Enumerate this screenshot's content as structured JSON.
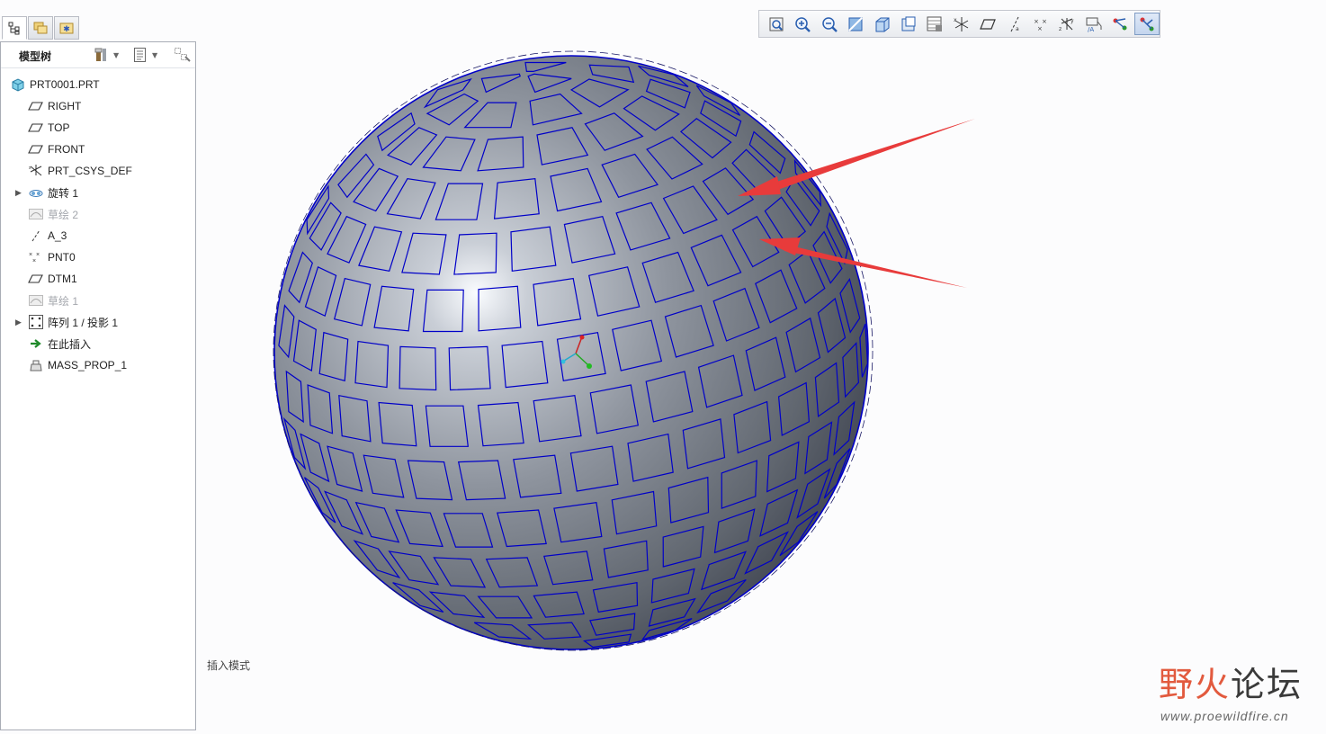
{
  "colors": {
    "accent": "#0000c8",
    "arrow": "#e83b3b",
    "panel_border": "#a9adb6",
    "watermark": "#e25a3e"
  },
  "tabs": [
    {
      "icon": "model-tree-icon",
      "active": true
    },
    {
      "icon": "folder-browser-icon",
      "active": false
    },
    {
      "icon": "favorites-icon",
      "active": false
    }
  ],
  "model_tree": {
    "title": "模型树",
    "header_icons": [
      "settings-tools-icon",
      "show-options-icon",
      "filter-icon"
    ],
    "items": [
      {
        "label": "PRT0001.PRT",
        "icon": "part-icon",
        "expandable": false,
        "muted": false
      },
      {
        "label": "RIGHT",
        "icon": "datum-plane-icon",
        "expandable": false,
        "muted": false
      },
      {
        "label": "TOP",
        "icon": "datum-plane-icon",
        "expandable": false,
        "muted": false
      },
      {
        "label": "FRONT",
        "icon": "datum-plane-icon",
        "expandable": false,
        "muted": false
      },
      {
        "label": "PRT_CSYS_DEF",
        "icon": "csys-icon",
        "expandable": false,
        "muted": false
      },
      {
        "label": "旋转 1",
        "icon": "revolve-icon",
        "expandable": true,
        "muted": false
      },
      {
        "label": "草绘 2",
        "icon": "sketch-icon",
        "expandable": false,
        "muted": true
      },
      {
        "label": "A_3",
        "icon": "datum-axis-icon",
        "expandable": false,
        "muted": false
      },
      {
        "label": "PNT0",
        "icon": "datum-point-icon",
        "expandable": false,
        "muted": false
      },
      {
        "label": "DTM1",
        "icon": "datum-plane-icon",
        "expandable": false,
        "muted": false
      },
      {
        "label": "草绘 1",
        "icon": "sketch-icon",
        "expandable": false,
        "muted": true
      },
      {
        "label": "阵列 1 / 投影 1",
        "icon": "pattern-icon",
        "expandable": true,
        "muted": false
      },
      {
        "label": "在此插入",
        "icon": "insert-here-icon",
        "expandable": false,
        "muted": false
      },
      {
        "label": "MASS_PROP_1",
        "icon": "mass-properties-icon",
        "expandable": false,
        "muted": false
      }
    ]
  },
  "toolbar": {
    "buttons": [
      "refit-icon",
      "zoom-in-icon",
      "zoom-out-icon",
      "repaint-icon",
      "display-style-icon",
      "saved-views-icon",
      "view-manager-icon",
      "plane-display-icon",
      "datum-plane-icon",
      "axis-display-icon",
      "point-display-icon",
      "csys-display-icon",
      "annotation-display-icon",
      "spin-center-icon",
      "mesh-display-icon"
    ],
    "active_index": 14
  },
  "status": {
    "text": "插入模式"
  },
  "watermark": {
    "title_a": "野火",
    "title_b": "论坛",
    "url": "www.proewildfire.cn"
  }
}
